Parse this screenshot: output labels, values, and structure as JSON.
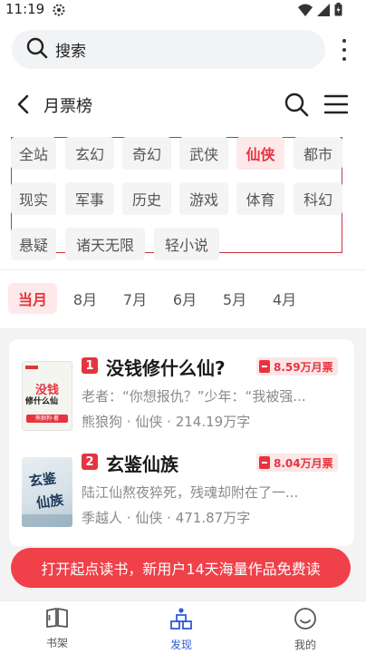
{
  "status_bar": {
    "time": "11:19"
  },
  "search": {
    "label": "搜索"
  },
  "title_bar": {
    "title": "月票榜"
  },
  "categories": [
    "全站",
    "玄幻",
    "奇幻",
    "武侠",
    "仙侠",
    "都市",
    "现实",
    "军事",
    "历史",
    "游戏",
    "体育",
    "科幻",
    "悬疑",
    "诸天无限",
    "轻小说"
  ],
  "selected_category": "仙侠",
  "months": [
    "当月",
    "8月",
    "7月",
    "6月",
    "5月",
    "4月"
  ],
  "selected_month": "当月",
  "books": [
    {
      "rank": "1",
      "title": "没钱修什么仙?",
      "tickets": "8.59万月票",
      "desc": "老者：“你想报仇？”少年：“我被强...",
      "author": "熊狼狗",
      "genre": "仙侠",
      "words": "214.19万字",
      "cover_text_1": "没钱",
      "cover_text_2": "修什么仙",
      "cover_caption": "熊狼狗·著"
    },
    {
      "rank": "2",
      "title": "玄鉴仙族",
      "tickets": "8.04万月票",
      "desc": "陆江仙熬夜猝死，残魂却附在了一...",
      "author": "季越人",
      "genre": "仙侠",
      "words": "471.87万字",
      "cover_text_1": "玄鉴",
      "cover_text_2": "仙族"
    }
  ],
  "meta_separator": "·",
  "promo": {
    "text": "打开起点读书，新用户14天海量作品免费读"
  },
  "nav": [
    {
      "label": "书架",
      "icon": "book-icon"
    },
    {
      "label": "发现",
      "icon": "discover-icon"
    },
    {
      "label": "我的",
      "icon": "smile-icon"
    }
  ],
  "colors": {
    "accent": "#e5343f",
    "nav_active": "#2f5bd8",
    "promo_bg": "#f04049"
  }
}
